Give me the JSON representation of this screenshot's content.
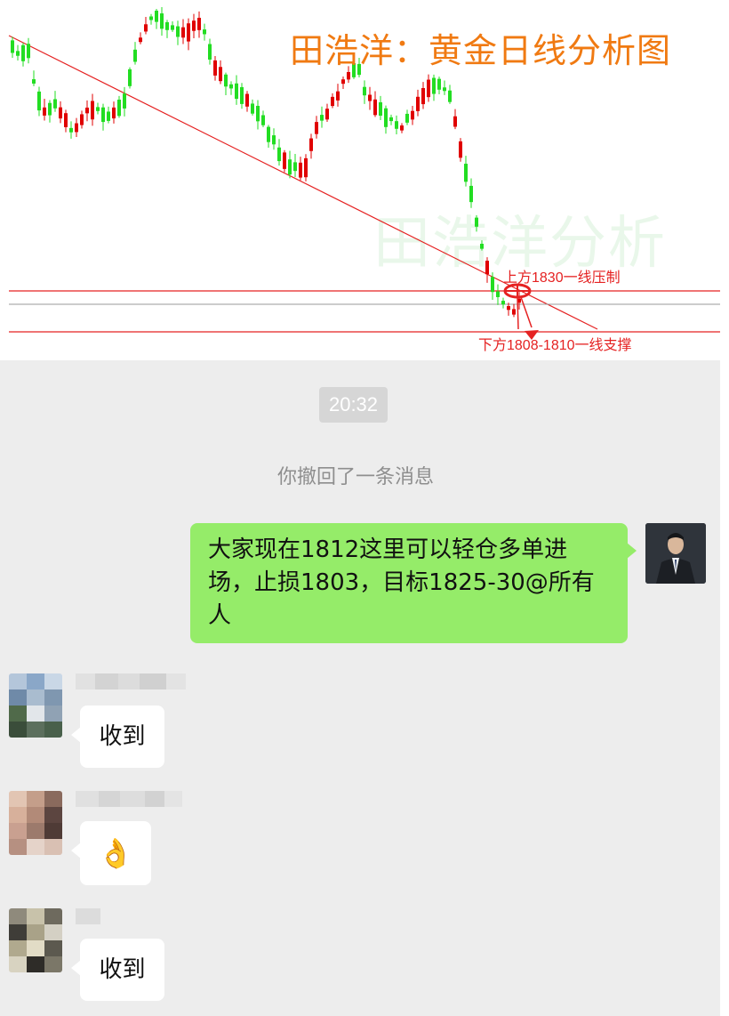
{
  "chart": {
    "title": "田浩洋：黄金日线分析图",
    "watermark": "田浩洋分析",
    "resistance_label": "上方1830一线压制",
    "support_label": "下方1808-1810一线支撑",
    "colors": {
      "up_candle": "#e00000",
      "down_candle": "#22dd22",
      "level_line": "#e52222",
      "mid_line": "#9a9a9a",
      "title": "#f07a12"
    }
  },
  "chat": {
    "time": "20:32",
    "system_notice": "你撤回了一条消息",
    "self_message": {
      "text": "大家现在1812这里可以轻仓多单进场，止损1803，目标1825-30@所有人",
      "avatar": "man-in-suit-avatar"
    },
    "messages": [
      {
        "content": "收到",
        "type": "text"
      },
      {
        "content": "👌",
        "type": "emoji",
        "emoji_name": "ok-hand-emoji"
      },
      {
        "content": "收到",
        "type": "text"
      }
    ]
  }
}
